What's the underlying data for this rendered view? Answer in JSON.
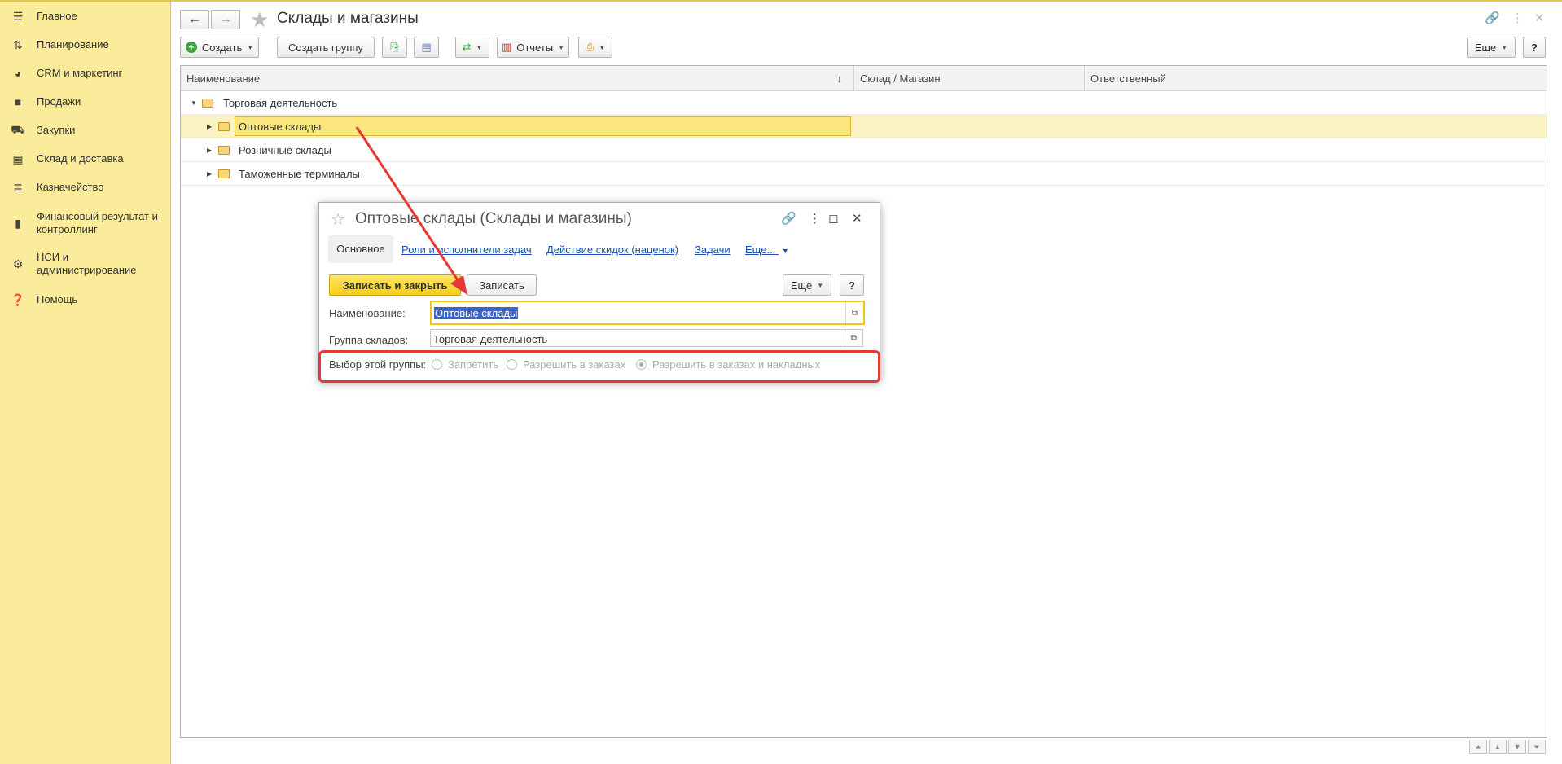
{
  "sidebar": {
    "items": [
      {
        "label": "Главное",
        "icon": "menu-icon"
      },
      {
        "label": "Планирование",
        "icon": "planning-icon"
      },
      {
        "label": "CRM и маркетинг",
        "icon": "pie-chart-icon"
      },
      {
        "label": "Продажи",
        "icon": "bag-icon"
      },
      {
        "label": "Закупки",
        "icon": "cart-icon"
      },
      {
        "label": "Склад и доставка",
        "icon": "grid-icon"
      },
      {
        "label": "Казначейство",
        "icon": "coins-icon"
      },
      {
        "label": "Финансовый результат и контроллинг",
        "icon": "bar-chart-icon"
      },
      {
        "label": "НСИ и администрирование",
        "icon": "gear-icon"
      },
      {
        "label": "Помощь",
        "icon": "help-icon"
      }
    ]
  },
  "header": {
    "title": "Склады и магазины"
  },
  "toolbar": {
    "create": "Создать",
    "create_group": "Создать группу",
    "reports": "Отчеты",
    "more": "Еще",
    "help": "?"
  },
  "table": {
    "columns": [
      "Наименование",
      "Склад / Магазин",
      "Ответственный"
    ],
    "sort_indicator": "↓",
    "rows": [
      {
        "name": "Торговая деятельность",
        "level": 0,
        "expanded": true
      },
      {
        "name": "Оптовые склады",
        "level": 1,
        "selected": true
      },
      {
        "name": "Розничные склады",
        "level": 1
      },
      {
        "name": "Таможенные терминалы",
        "level": 1
      }
    ]
  },
  "dialog": {
    "title": "Оптовые склады (Склады и магазины)",
    "tabs": {
      "main": "Основное",
      "roles": "Роли и исполнители задач",
      "discounts": "Действие скидок (наценок)",
      "tasks": "Задачи",
      "more": "Еще..."
    },
    "buttons": {
      "save_close": "Записать и закрыть",
      "save": "Записать",
      "more": "Еще",
      "help": "?"
    },
    "fields": {
      "name_label": "Наименование:",
      "name_value": "Оптовые склады",
      "group_label": "Группа складов:",
      "group_value": "Торговая деятельность"
    },
    "selection": {
      "label": "Выбор этой группы:",
      "options": [
        "Запретить",
        "Разрешить в заказах",
        "Разрешить в заказах и накладных"
      ],
      "checked_index": 2
    }
  },
  "colors": {
    "sidebar_bg": "#fbec9c",
    "primary_button": "#f4cf17",
    "highlight": "#e53935",
    "link": "#1c4fb3"
  }
}
